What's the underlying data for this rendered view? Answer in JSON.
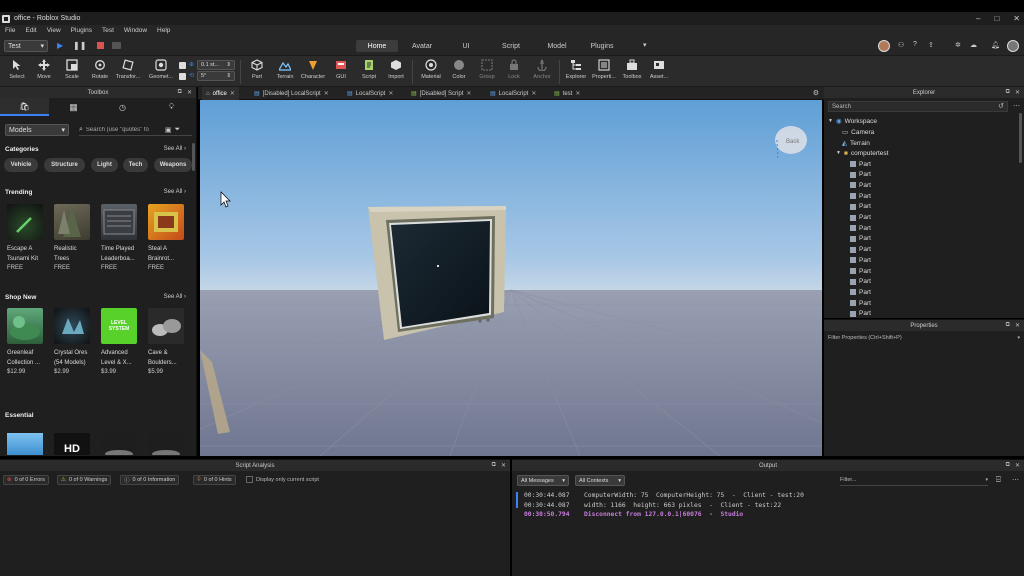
{
  "window": {
    "title": "office - Roblox Studio",
    "minimize_glyph": "–",
    "maximize_glyph": "□",
    "close_glyph": "✕"
  },
  "menu": [
    "File",
    "Edit",
    "View",
    "Plugins",
    "Test",
    "Window",
    "Help"
  ],
  "top": {
    "mode_value": "Test",
    "tabs": [
      {
        "label": "Home",
        "active": true
      },
      {
        "label": "Avatar",
        "active": false
      },
      {
        "label": "UI",
        "active": false
      },
      {
        "label": "Script",
        "active": false
      },
      {
        "label": "Model",
        "active": false
      },
      {
        "label": "Plugins",
        "active": false
      }
    ]
  },
  "ribbon": {
    "tools": [
      "Select",
      "Move",
      "Scale",
      "Rotate",
      "Transfor...",
      "Geomet..."
    ],
    "move_step": "0.1 st...",
    "rotate_step": "5°",
    "insert_tools": [
      "Part",
      "Terrain",
      "Character",
      "GUI",
      "Script",
      "Import"
    ],
    "appearance_tools": [
      "Material",
      "Color",
      "Group",
      "Lock",
      "Anchor"
    ],
    "panel_tools": [
      "Explorer",
      "Properti...",
      "Toolbox",
      "Asset..."
    ]
  },
  "toolbox": {
    "title": "Toolbox",
    "category_value": "Models",
    "search_placeholder": "Search (use \"quotes\" fo",
    "categories_title": "Categories",
    "see_all": "See All",
    "chips": [
      "Vehicle",
      "Structure",
      "Light",
      "Tech",
      "Weapons"
    ],
    "trending_title": "Trending",
    "trending": [
      {
        "name": "Escape A",
        "name2": "Tsunami Kit",
        "price": "FREE"
      },
      {
        "name": "Realistic",
        "name2": "Trees",
        "price": "FREE"
      },
      {
        "name": "Time Played",
        "name2": "Leaderboa...",
        "price": "FREE"
      },
      {
        "name": "Steal A",
        "name2": "Brainrot...",
        "price": "FREE"
      }
    ],
    "shopnew_title": "Shop New",
    "shopnew": [
      {
        "name": "Greenleaf",
        "name2": "Collection ...",
        "price": "$12.99"
      },
      {
        "name": "Crystal Ores",
        "name2": "(54 Models)",
        "price": "$2.99"
      },
      {
        "name": "Advanced",
        "name2": "Level & X...",
        "price": "$3.99"
      },
      {
        "name": "Cave &",
        "name2": "Boulders...",
        "price": "$5.99"
      }
    ],
    "essential_title": "Essential",
    "thumb_text_lvl": "LEVEL SYSTEM",
    "thumb_text_hd": "HD"
  },
  "doc_tabs": [
    {
      "label": "office",
      "active": true
    },
    {
      "label": "[Disabled] LocalScript",
      "active": false
    },
    {
      "label": "LocalScript",
      "active": false
    },
    {
      "label": "[Disabled] Script",
      "active": false
    },
    {
      "label": "LocalScript",
      "active": false
    },
    {
      "label": "test",
      "active": false
    }
  ],
  "viewport": {
    "back_label": "Back"
  },
  "explorer": {
    "title": "Explorer",
    "search_placeholder": "Search",
    "workspace": "Workspace",
    "camera": "Camera",
    "terrain": "Terrain",
    "model": "computertest",
    "parts": [
      "Part",
      "Part",
      "Part",
      "Part",
      "Part",
      "Part",
      "Part",
      "Part",
      "Part",
      "Part",
      "Part",
      "Part",
      "Part",
      "Part",
      "Part"
    ]
  },
  "properties": {
    "title": "Properties",
    "filter_placeholder": "Filter Properties (Ctrl+Shift+P)"
  },
  "script_analysis": {
    "title": "Script Analysis",
    "errors": "0 of 0 Errors",
    "warnings": "0 of 0 Warnings",
    "info": "0 of 0 Information",
    "hints": "0 of 0 Hints",
    "current_script_label": "Display only current script"
  },
  "output": {
    "title": "Output",
    "messages_filter": "All Messages",
    "contexts_filter": "All Contexts",
    "filter_placeholder": "Filter...",
    "lines": [
      {
        "time": "00:30:44.087",
        "text": "ComputerWidth: 75  ComputerHeight: 75  -  Client - test:20",
        "color": "#cccccc"
      },
      {
        "time": "00:30:44.087",
        "text": "width: 1166  height: 663 pixles  -  Client - test:22",
        "color": "#cccccc"
      },
      {
        "time": "00:30:50.794",
        "text": "Disconnect from 127.0.0.1|60076  -  Studio",
        "color": "#c77ddb"
      }
    ]
  },
  "colors": {
    "accent": "#3b82f6",
    "sky_top": "#6aa6d8",
    "ground": "#7f86a0"
  }
}
